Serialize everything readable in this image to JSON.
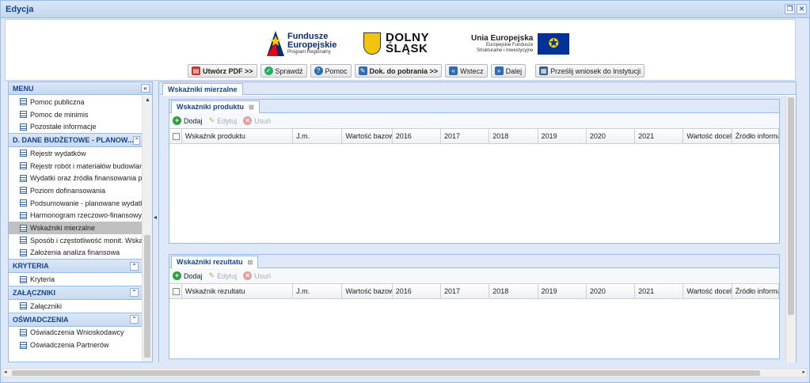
{
  "window": {
    "title": "Edycja"
  },
  "logos": {
    "fe_line1": "Fundusze",
    "fe_line2": "Europejskie",
    "fe_line3": "Program Regionalny",
    "ds_line1": "DOLNY",
    "ds_line2": "ŚLĄSK",
    "ue_line1": "Unia Europejska",
    "ue_line2": "Europejskie Fundusze",
    "ue_line3": "Strukturalne i Inwestycyjne"
  },
  "toolbar": {
    "pdf": "Utwórz PDF >>",
    "check": "Sprawdź",
    "help": "Pomoc",
    "download": "Dok. do pobrania >>",
    "back": "Wstecz",
    "next": "Dalej",
    "send": "Prześlij wniosek do Instytucji"
  },
  "sidebar": {
    "header": "MENU",
    "items_top": [
      "Pomoc publiczna",
      "Pomoc de minimis",
      "Pozostałe informacje"
    ],
    "group_d": "D. DANE BUDŻETOWE - PLANOW...",
    "items_d": [
      "Rejestr wydatków",
      "Rejestr robót i materiałów budowlanych",
      "Wydatki oraz źródła finansowania projektu",
      "Poziom dofinansowania",
      "Podsumowanie - planowane wydatki w",
      "Harmonogram rzeczowo-finansowy",
      "Wskaźniki mierzalne",
      "Sposób i częstotliwość monit. Wskaźników",
      "Założenia analiza finansowa"
    ],
    "group_k": "KRYTERIA",
    "items_k": [
      "Kryteria"
    ],
    "group_z": "ZAŁĄCZNIKI",
    "items_z": [
      "Załączniki"
    ],
    "group_o": "OŚWIADCZENIA",
    "items_o": [
      "Oświadczenia Wnioskodawcy",
      "Oświadczenia Partnerów"
    ]
  },
  "main": {
    "tab": "Wskaźniki mierzalne",
    "product": {
      "tab": "Wskaźniki produktu",
      "add": "Dodaj",
      "edit": "Edytuj",
      "delete": "Usuń",
      "columns": [
        "Wskaźnik produktu",
        "J.m.",
        "Wartość bazowa",
        "2016",
        "2017",
        "2018",
        "2019",
        "2020",
        "2021",
        "Wartość docelowa",
        "Źródło informacji"
      ]
    },
    "result": {
      "tab": "Wskaźniki rezultatu",
      "add": "Dodaj",
      "edit": "Edytuj",
      "delete": "Usuń",
      "columns": [
        "Wskaźnik rezultatu",
        "J.m.",
        "Wartość bazowa",
        "2016",
        "2017",
        "2018",
        "2019",
        "2020",
        "2021",
        "Wartość docelowa",
        "Źródło informacji"
      ]
    }
  }
}
